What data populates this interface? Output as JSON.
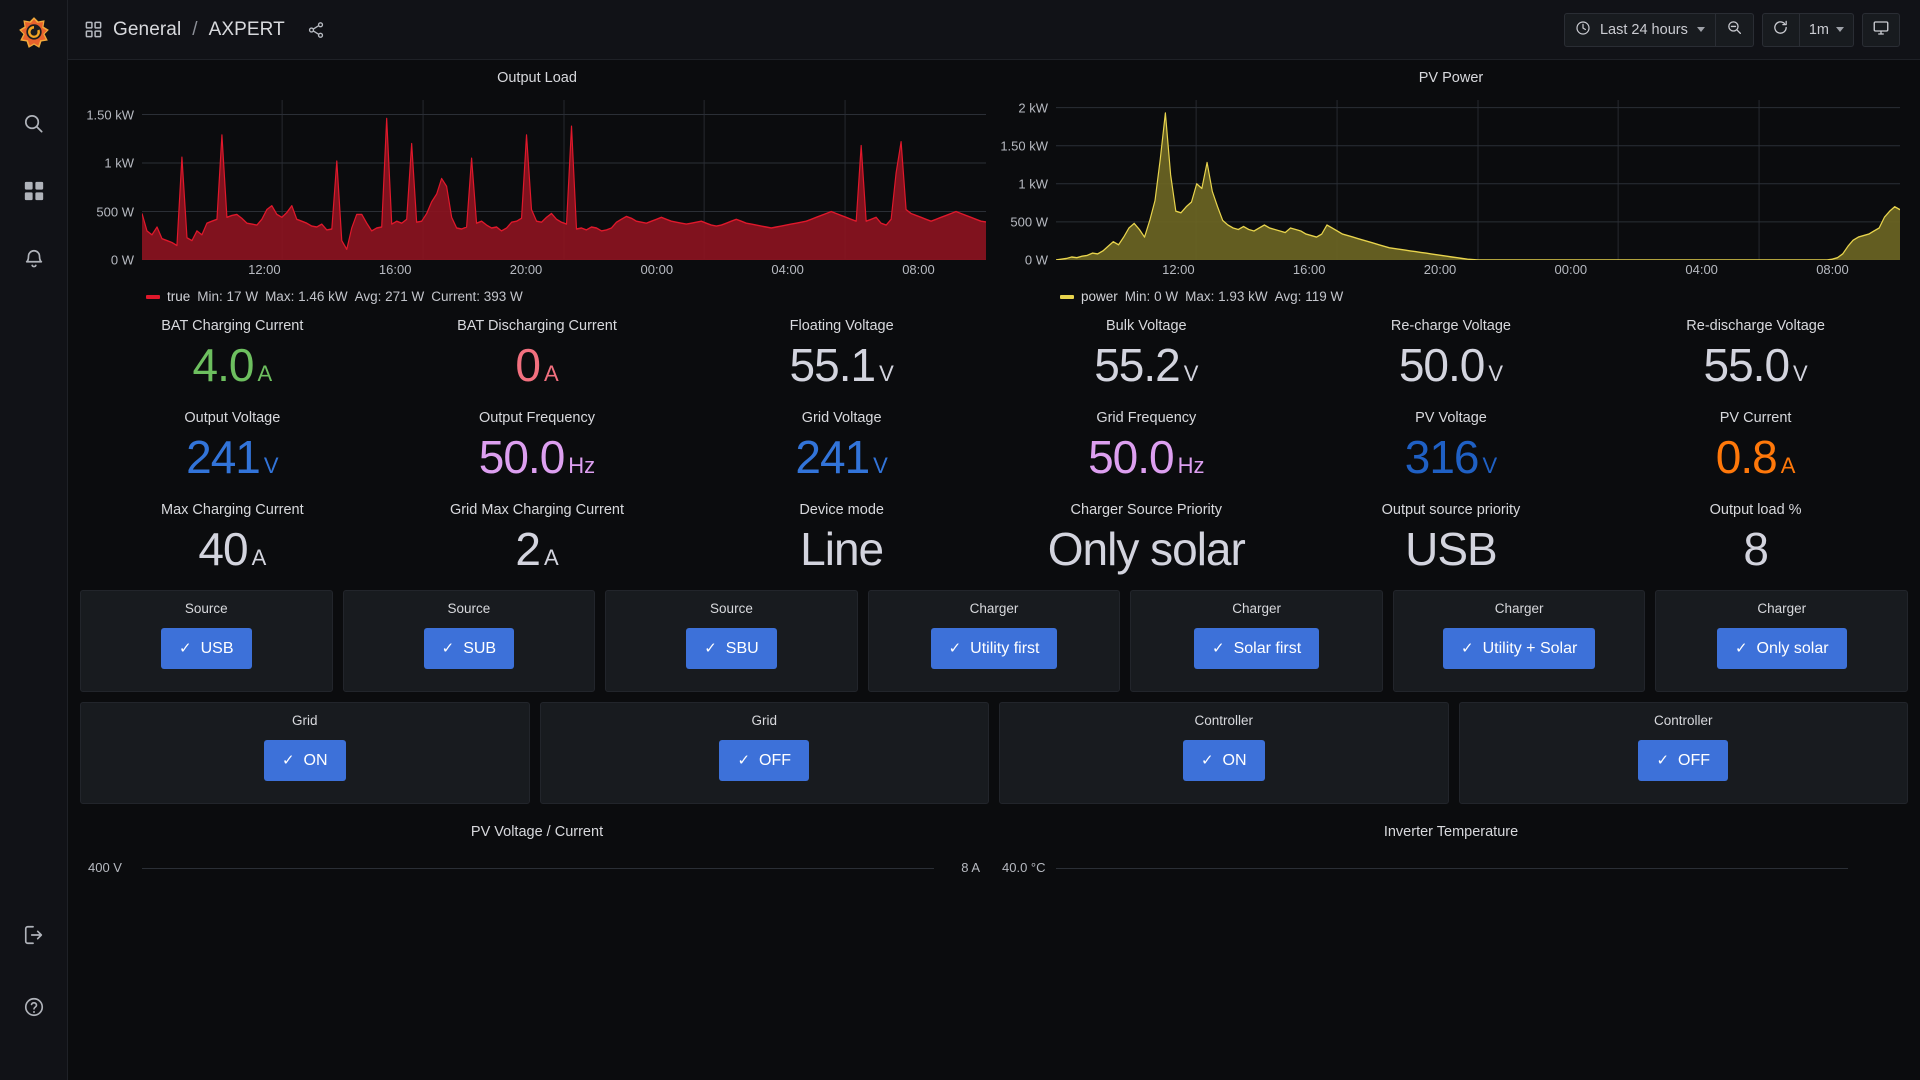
{
  "nav": {
    "logo": "grafana-logo",
    "items": [
      {
        "name": "search",
        "icon": "search-icon"
      },
      {
        "name": "dashboards",
        "icon": "grid-icon"
      },
      {
        "name": "alerting",
        "icon": "bell-icon"
      }
    ],
    "bottom": [
      {
        "name": "sign-in",
        "icon": "signin-icon"
      },
      {
        "name": "help",
        "icon": "help-circle-icon"
      }
    ]
  },
  "header": {
    "grid_icon": "dashboard-grid-icon",
    "folder": "General",
    "separator": "/",
    "dashboard": "AXPERT",
    "share_icon": "share-icon",
    "time_picker": {
      "icon": "clock-icon",
      "label": "Last 24 hours",
      "caret": "chevron-down-icon"
    },
    "zoom_out": {
      "icon": "zoom-out-icon"
    },
    "refresh": {
      "icon": "refresh-icon"
    },
    "interval": {
      "label": "1m",
      "caret": "chevron-down-icon"
    },
    "kiosk": {
      "icon": "monitor-icon"
    }
  },
  "chart_data": [
    {
      "type": "area",
      "title": "Output Load",
      "color": "#e0182b",
      "fill": "#8b1420",
      "ylabel": "",
      "xlabel": "",
      "ylim": [
        0,
        1650
      ],
      "yticks": [
        0,
        500,
        1000,
        1500
      ],
      "ytick_labels": [
        "0 W",
        "500 W",
        "1 kW",
        "1.50 kW"
      ],
      "xticks": [
        "12:00",
        "16:00",
        "20:00",
        "00:00",
        "04:00",
        "08:00"
      ],
      "grid": true,
      "legend": {
        "position": "bottom",
        "name": "true",
        "stats": [
          {
            "label": "Min:",
            "value": "17 W"
          },
          {
            "label": "Max:",
            "value": "1.46 kW"
          },
          {
            "label": "Avg:",
            "value": "271 W"
          },
          {
            "label": "Current:",
            "value": "393 W"
          }
        ]
      },
      "series": [
        {
          "name": "true",
          "values": [
            480,
            300,
            260,
            340,
            220,
            200,
            180,
            150,
            1060,
            230,
            200,
            300,
            260,
            380,
            400,
            420,
            1290,
            440,
            460,
            470,
            430,
            380,
            370,
            360,
            420,
            520,
            560,
            470,
            440,
            490,
            560,
            420,
            400,
            380,
            350,
            340,
            370,
            310,
            320,
            1020,
            200,
            110,
            330,
            470,
            470,
            380,
            300,
            330,
            340,
            1460,
            370,
            400,
            380,
            420,
            1200,
            390,
            400,
            480,
            600,
            680,
            840,
            760,
            440,
            330,
            320,
            340,
            1050,
            380,
            400,
            360,
            330,
            340,
            300,
            330,
            390,
            400,
            430,
            1290,
            520,
            400,
            390,
            440,
            480,
            420,
            390,
            370,
            1380,
            320,
            330,
            310,
            340,
            330,
            300,
            310,
            330,
            390,
            420,
            450,
            430,
            400,
            390,
            380,
            400,
            420,
            440,
            420,
            400,
            390,
            380,
            370,
            380,
            390,
            400,
            380,
            360,
            350,
            360,
            380,
            400,
            420,
            400,
            380,
            370,
            360,
            350,
            340,
            330,
            340,
            350,
            360,
            370,
            380,
            390,
            400,
            420,
            440,
            460,
            480,
            500,
            480,
            460,
            440,
            420,
            400,
            1180,
            400,
            420,
            440,
            380,
            360,
            420,
            900,
            1220,
            520,
            480,
            460,
            440,
            420,
            400,
            420,
            440,
            460,
            480,
            500,
            480,
            460,
            440,
            420,
            400,
            393
          ]
        }
      ]
    },
    {
      "type": "area",
      "title": "PV Power",
      "color": "#e8d44d",
      "fill": "#6b6523",
      "ylabel": "",
      "xlabel": "",
      "ylim": [
        0,
        2100
      ],
      "yticks": [
        0,
        500,
        1000,
        1500,
        2000
      ],
      "ytick_labels": [
        "0 W",
        "500 W",
        "1 kW",
        "1.50 kW",
        "2 kW"
      ],
      "xticks": [
        "12:00",
        "16:00",
        "20:00",
        "00:00",
        "04:00",
        "08:00"
      ],
      "grid": true,
      "legend": {
        "position": "bottom",
        "name": "power",
        "stats": [
          {
            "label": "Min:",
            "value": "0 W"
          },
          {
            "label": "Max:",
            "value": "1.93 kW"
          },
          {
            "label": "Avg:",
            "value": "119 W"
          }
        ]
      },
      "series": [
        {
          "name": "power",
          "values": [
            0,
            10,
            20,
            40,
            30,
            50,
            60,
            90,
            80,
            120,
            180,
            240,
            200,
            300,
            420,
            480,
            400,
            300,
            520,
            780,
            1320,
            1930,
            1120,
            640,
            620,
            700,
            760,
            1000,
            940,
            1280,
            900,
            700,
            520,
            460,
            420,
            400,
            440,
            400,
            380,
            420,
            460,
            420,
            400,
            380,
            360,
            420,
            400,
            380,
            340,
            320,
            300,
            340,
            460,
            420,
            380,
            340,
            320,
            300,
            280,
            260,
            240,
            220,
            200,
            180,
            160,
            150,
            140,
            130,
            120,
            110,
            100,
            90,
            80,
            70,
            60,
            50,
            40,
            30,
            20,
            10,
            5,
            0,
            0,
            0,
            0,
            0,
            0,
            0,
            0,
            0,
            0,
            0,
            0,
            0,
            0,
            0,
            0,
            0,
            0,
            0,
            0,
            0,
            0,
            0,
            0,
            0,
            0,
            0,
            0,
            0,
            0,
            0,
            0,
            0,
            0,
            0,
            0,
            0,
            0,
            0,
            0,
            0,
            0,
            0,
            0,
            0,
            0,
            0,
            0,
            0,
            0,
            0,
            0,
            0,
            0,
            0,
            0,
            0,
            0,
            0,
            0,
            0,
            0,
            0,
            0,
            0,
            0,
            0,
            0,
            10,
            30,
            80,
            180,
            260,
            300,
            320,
            340,
            380,
            420,
            560,
            640,
            700,
            660
          ]
        }
      ]
    }
  ],
  "stats_row1": [
    {
      "title": "BAT Charging Current",
      "value": "4.0",
      "unit": "A",
      "color": "#6dbf5f"
    },
    {
      "title": "BAT Discharging Current",
      "value": "0",
      "unit": "A",
      "color": "#f2707f"
    },
    {
      "title": "Floating Voltage",
      "value": "55.1",
      "unit": "V",
      "color": "#d3d4de"
    },
    {
      "title": "Bulk Voltage",
      "value": "55.2",
      "unit": "V",
      "color": "#d3d4de"
    },
    {
      "title": "Re-charge Voltage",
      "value": "50.0",
      "unit": "V",
      "color": "#d3d4de"
    },
    {
      "title": "Re-discharge Voltage",
      "value": "55.0",
      "unit": "V",
      "color": "#d3d4de"
    }
  ],
  "stats_row2": [
    {
      "title": "Output Voltage",
      "value": "241",
      "unit": "V",
      "color": "#3274d9"
    },
    {
      "title": "Output Frequency",
      "value": "50.0",
      "unit": "Hz",
      "color": "#dd9ff0"
    },
    {
      "title": "Grid Voltage",
      "value": "241",
      "unit": "V",
      "color": "#3274d9"
    },
    {
      "title": "Grid Frequency",
      "value": "50.0",
      "unit": "Hz",
      "color": "#dd9ff0"
    },
    {
      "title": "PV Voltage",
      "value": "316",
      "unit": "V",
      "color": "#1f60c4"
    },
    {
      "title": "PV Current",
      "value": "0.8",
      "unit": "A",
      "color": "#ff780a"
    }
  ],
  "stats_row3": [
    {
      "title": "Max Charging Current",
      "value": "40",
      "unit": "A",
      "color": "#d3d4de"
    },
    {
      "title": "Grid Max Charging Current",
      "value": "2",
      "unit": "A",
      "color": "#d3d4de"
    },
    {
      "title": "Device mode",
      "value": "Line",
      "unit": "",
      "color": "#d3d4de"
    },
    {
      "title": "Charger Source Priority",
      "value": "Only solar",
      "unit": "",
      "color": "#d3d4de"
    },
    {
      "title": "Output source priority",
      "value": "USB",
      "unit": "",
      "color": "#d3d4de"
    },
    {
      "title": "Output load %",
      "value": "8",
      "unit": "",
      "color": "#d3d4de"
    }
  ],
  "buttons_row1": [
    {
      "title": "Source",
      "label": "USB",
      "check": "✓"
    },
    {
      "title": "Source",
      "label": "SUB",
      "check": "✓"
    },
    {
      "title": "Source",
      "label": "SBU",
      "check": "✓"
    },
    {
      "title": "Charger",
      "label": "Utility first",
      "check": "✓"
    },
    {
      "title": "Charger",
      "label": "Solar first",
      "check": "✓"
    },
    {
      "title": "Charger",
      "label": "Utility + Solar",
      "check": "✓"
    },
    {
      "title": "Charger",
      "label": "Only solar",
      "check": "✓"
    }
  ],
  "buttons_row2": [
    {
      "title": "Grid",
      "label": "ON",
      "check": "✓"
    },
    {
      "title": "Grid",
      "label": "OFF",
      "check": "✓"
    },
    {
      "title": "Controller",
      "label": "ON",
      "check": "✓"
    },
    {
      "title": "Controller",
      "label": "OFF",
      "check": "✓"
    }
  ],
  "bottom_panels": [
    {
      "title": "PV Voltage / Current",
      "left_label": "400 V",
      "right_label": "8 A"
    },
    {
      "title": "Inverter Temperature",
      "left_label": "40.0 °C",
      "right_label": ""
    }
  ]
}
